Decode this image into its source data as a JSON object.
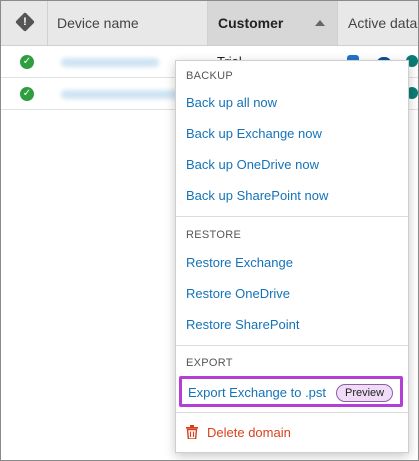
{
  "table": {
    "columns": {
      "device": "Device name",
      "customer": "Customer",
      "active": "Active data"
    },
    "rows": [
      {
        "status": "ok",
        "customer": "Trial"
      },
      {
        "status": "ok",
        "customer": ""
      }
    ]
  },
  "menu": {
    "backup": {
      "section": "BACKUP",
      "items": [
        "Back up all now",
        "Back up Exchange now",
        "Back up OneDrive now",
        "Back up SharePoint now"
      ]
    },
    "restore": {
      "section": "RESTORE",
      "items": [
        "Restore Exchange",
        "Restore OneDrive",
        "Restore SharePoint"
      ]
    },
    "export": {
      "section": "EXPORT",
      "item": "Export Exchange to .pst",
      "badge": "Preview"
    },
    "delete": "Delete domain"
  },
  "icons": {
    "status_header": "warning-diamond-icon",
    "row_status": "check-circle-icon",
    "delete": "trash-icon",
    "services": [
      "exchange-icon",
      "onedrive-icon",
      "sharepoint-icon"
    ]
  },
  "colors": {
    "link": "#1473b8",
    "danger": "#d9411e",
    "success": "#2e9e3e",
    "highlight": "#b33fd8",
    "badge_bg": "#f0dcf6"
  }
}
